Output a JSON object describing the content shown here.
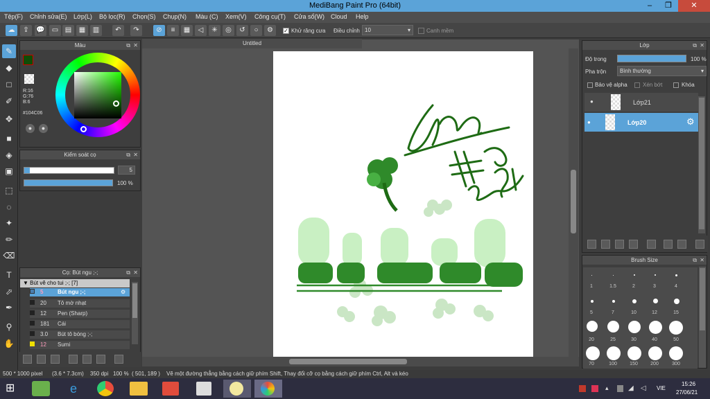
{
  "window": {
    "title": "MediBang Paint Pro (64bit)"
  },
  "menu": [
    "Tệp(F)",
    "Chỉnh sửa(E)",
    "Lớp(L)",
    "Bộ lọc(R)",
    "Chọn(S)",
    "Chụp(N)",
    "Màu (C)",
    "Xem(V)",
    "Công cụ(T)",
    "Cửa sổ(W)",
    "Cloud",
    "Help"
  ],
  "toolbar": {
    "antialias_label": "Khử răng cưa",
    "adjust_label": "Điều chỉnh",
    "adjust_value": "10",
    "canh_le_label": "Canh mềm"
  },
  "color_panel": {
    "title": "Màu",
    "r": "R:16",
    "g": "G:76",
    "b": "B:6",
    "hex": "#104C06",
    "fg": "#104C06"
  },
  "brush_control": {
    "title": "Kiểm soát cọ",
    "size_value": "5",
    "opacity_value": "100 %"
  },
  "brush_panel": {
    "title": "Cọ: Bút ngu ;-;",
    "group": "Bút vẽ cho tui ;-; [7]",
    "items": [
      {
        "size": "5",
        "name": "Bút ngu ;-;",
        "selected": true
      },
      {
        "size": "20",
        "name": "Tô mờ nhạt"
      },
      {
        "size": "12",
        "name": "Pen (Sharp)"
      },
      {
        "size": "181",
        "name": "Cái"
      },
      {
        "size": "3.0",
        "name": "Bút tô bóng ;-;"
      },
      {
        "size": "12",
        "name": "Sumi"
      }
    ]
  },
  "canvas": {
    "tab": "Untitled"
  },
  "layer_panel": {
    "title": "Lớp",
    "opacity_label": "Độ trong",
    "opacity_value": "100 %",
    "blend_label": "Pha trộn",
    "blend_value": "Bình thường",
    "protect_alpha": "Bảo vệ alpha",
    "clip": "Xén bớt",
    "lock": "Khóa",
    "layers": [
      {
        "name": "Lớp21",
        "selected": false
      },
      {
        "name": "Lớp20",
        "selected": true
      }
    ]
  },
  "brush_size_panel": {
    "title": "Brush Size",
    "sizes": [
      "1",
      "1.5",
      "2",
      "3",
      "4",
      "5",
      "7",
      "10",
      "12",
      "15",
      "20",
      "25",
      "30",
      "40",
      "50",
      "70",
      "100",
      "150",
      "200",
      "300"
    ]
  },
  "status": {
    "dims": "500 * 1000 pixel",
    "cm": "(3.6 * 7.3cm)",
    "dpi": "350 dpi",
    "zoom": "100 %",
    "coords": "( 501, 189 )",
    "hint": "Vẽ một đường thẳng bằng cách giữ phím Shift, Thay đổi cỡ cọ bằng cách giữ phím Ctrl, Alt và kéo"
  },
  "taskbar": {
    "lang": "VIE",
    "time": "15:26",
    "date": "27/06/21"
  }
}
